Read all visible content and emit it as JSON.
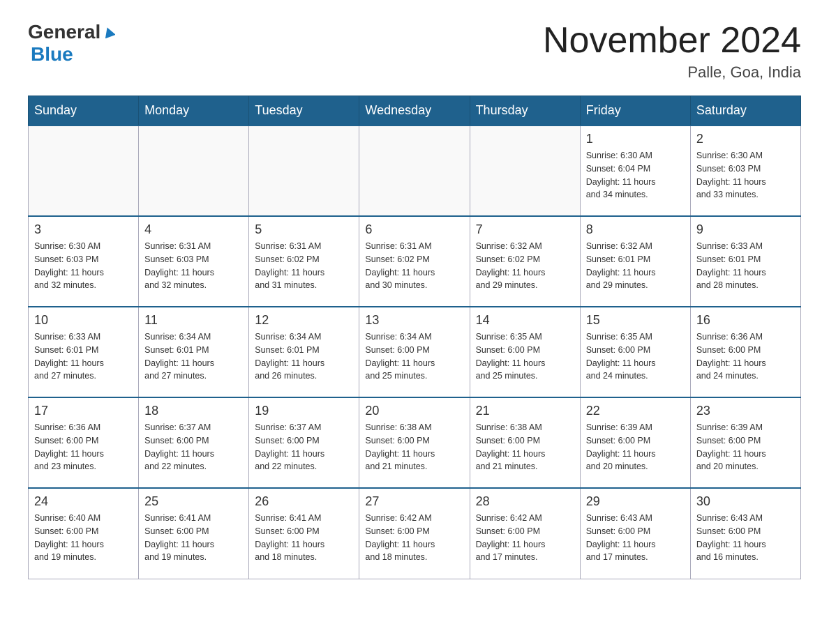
{
  "header": {
    "logo_general": "General",
    "logo_blue": "Blue",
    "month_title": "November 2024",
    "location": "Palle, Goa, India"
  },
  "weekdays": [
    "Sunday",
    "Monday",
    "Tuesday",
    "Wednesday",
    "Thursday",
    "Friday",
    "Saturday"
  ],
  "weeks": [
    [
      {
        "day": "",
        "info": ""
      },
      {
        "day": "",
        "info": ""
      },
      {
        "day": "",
        "info": ""
      },
      {
        "day": "",
        "info": ""
      },
      {
        "day": "",
        "info": ""
      },
      {
        "day": "1",
        "info": "Sunrise: 6:30 AM\nSunset: 6:04 PM\nDaylight: 11 hours\nand 34 minutes."
      },
      {
        "day": "2",
        "info": "Sunrise: 6:30 AM\nSunset: 6:03 PM\nDaylight: 11 hours\nand 33 minutes."
      }
    ],
    [
      {
        "day": "3",
        "info": "Sunrise: 6:30 AM\nSunset: 6:03 PM\nDaylight: 11 hours\nand 32 minutes."
      },
      {
        "day": "4",
        "info": "Sunrise: 6:31 AM\nSunset: 6:03 PM\nDaylight: 11 hours\nand 32 minutes."
      },
      {
        "day": "5",
        "info": "Sunrise: 6:31 AM\nSunset: 6:02 PM\nDaylight: 11 hours\nand 31 minutes."
      },
      {
        "day": "6",
        "info": "Sunrise: 6:31 AM\nSunset: 6:02 PM\nDaylight: 11 hours\nand 30 minutes."
      },
      {
        "day": "7",
        "info": "Sunrise: 6:32 AM\nSunset: 6:02 PM\nDaylight: 11 hours\nand 29 minutes."
      },
      {
        "day": "8",
        "info": "Sunrise: 6:32 AM\nSunset: 6:01 PM\nDaylight: 11 hours\nand 29 minutes."
      },
      {
        "day": "9",
        "info": "Sunrise: 6:33 AM\nSunset: 6:01 PM\nDaylight: 11 hours\nand 28 minutes."
      }
    ],
    [
      {
        "day": "10",
        "info": "Sunrise: 6:33 AM\nSunset: 6:01 PM\nDaylight: 11 hours\nand 27 minutes."
      },
      {
        "day": "11",
        "info": "Sunrise: 6:34 AM\nSunset: 6:01 PM\nDaylight: 11 hours\nand 27 minutes."
      },
      {
        "day": "12",
        "info": "Sunrise: 6:34 AM\nSunset: 6:01 PM\nDaylight: 11 hours\nand 26 minutes."
      },
      {
        "day": "13",
        "info": "Sunrise: 6:34 AM\nSunset: 6:00 PM\nDaylight: 11 hours\nand 25 minutes."
      },
      {
        "day": "14",
        "info": "Sunrise: 6:35 AM\nSunset: 6:00 PM\nDaylight: 11 hours\nand 25 minutes."
      },
      {
        "day": "15",
        "info": "Sunrise: 6:35 AM\nSunset: 6:00 PM\nDaylight: 11 hours\nand 24 minutes."
      },
      {
        "day": "16",
        "info": "Sunrise: 6:36 AM\nSunset: 6:00 PM\nDaylight: 11 hours\nand 24 minutes."
      }
    ],
    [
      {
        "day": "17",
        "info": "Sunrise: 6:36 AM\nSunset: 6:00 PM\nDaylight: 11 hours\nand 23 minutes."
      },
      {
        "day": "18",
        "info": "Sunrise: 6:37 AM\nSunset: 6:00 PM\nDaylight: 11 hours\nand 22 minutes."
      },
      {
        "day": "19",
        "info": "Sunrise: 6:37 AM\nSunset: 6:00 PM\nDaylight: 11 hours\nand 22 minutes."
      },
      {
        "day": "20",
        "info": "Sunrise: 6:38 AM\nSunset: 6:00 PM\nDaylight: 11 hours\nand 21 minutes."
      },
      {
        "day": "21",
        "info": "Sunrise: 6:38 AM\nSunset: 6:00 PM\nDaylight: 11 hours\nand 21 minutes."
      },
      {
        "day": "22",
        "info": "Sunrise: 6:39 AM\nSunset: 6:00 PM\nDaylight: 11 hours\nand 20 minutes."
      },
      {
        "day": "23",
        "info": "Sunrise: 6:39 AM\nSunset: 6:00 PM\nDaylight: 11 hours\nand 20 minutes."
      }
    ],
    [
      {
        "day": "24",
        "info": "Sunrise: 6:40 AM\nSunset: 6:00 PM\nDaylight: 11 hours\nand 19 minutes."
      },
      {
        "day": "25",
        "info": "Sunrise: 6:41 AM\nSunset: 6:00 PM\nDaylight: 11 hours\nand 19 minutes."
      },
      {
        "day": "26",
        "info": "Sunrise: 6:41 AM\nSunset: 6:00 PM\nDaylight: 11 hours\nand 18 minutes."
      },
      {
        "day": "27",
        "info": "Sunrise: 6:42 AM\nSunset: 6:00 PM\nDaylight: 11 hours\nand 18 minutes."
      },
      {
        "day": "28",
        "info": "Sunrise: 6:42 AM\nSunset: 6:00 PM\nDaylight: 11 hours\nand 17 minutes."
      },
      {
        "day": "29",
        "info": "Sunrise: 6:43 AM\nSunset: 6:00 PM\nDaylight: 11 hours\nand 17 minutes."
      },
      {
        "day": "30",
        "info": "Sunrise: 6:43 AM\nSunset: 6:00 PM\nDaylight: 11 hours\nand 16 minutes."
      }
    ]
  ]
}
